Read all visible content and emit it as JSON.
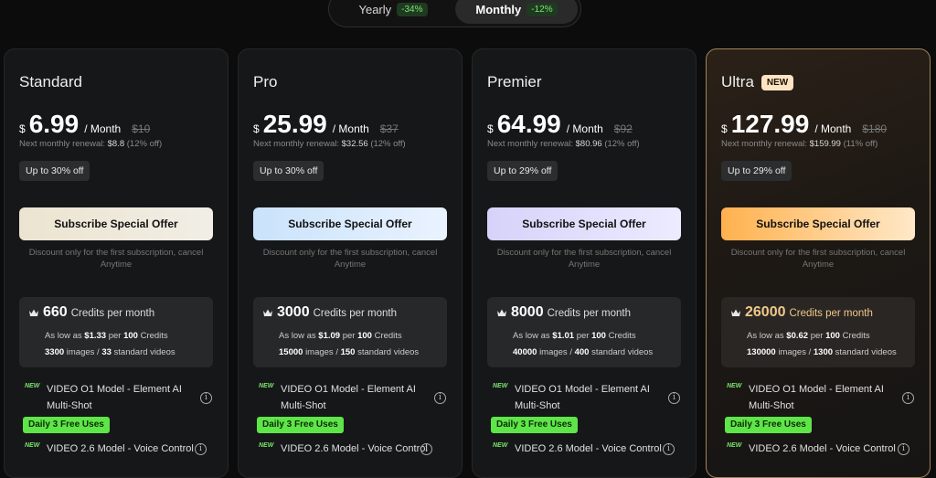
{
  "billing_toggle": {
    "yearly_label": "Yearly",
    "yearly_discount": "-34%",
    "monthly_label": "Monthly",
    "monthly_discount": "-12%",
    "selected": "Monthly"
  },
  "plans": [
    {
      "name": "Standard",
      "currency": "$",
      "price": "6.99",
      "per": "/ Month",
      "original_price": "$10",
      "renewal_label": "Next monthly renewal:",
      "renewal_price": "$8.8",
      "renewal_off": "(12% off)",
      "up_to": "Up to 30% off",
      "button_label": "Subscribe Special Offer",
      "note": "Discount only for the first subscription, cancel Anytime",
      "credits": "660",
      "credits_label": "Credits per month",
      "as_low_as": "As low as",
      "low_price": "$1.33",
      "per_word": "per",
      "per_credits": "100",
      "credits_word": "Credits",
      "images": "3300",
      "images_label": "images /",
      "videos": "33",
      "videos_label": "standard videos",
      "feature1_new": "NEW",
      "feature1": "VIDEO O1 Model - Element AI Multi-Shot",
      "free_badge": "Daily 3 Free Uses",
      "feature2_new": "NEW",
      "feature2": "VIDEO 2.6 Model - Voice Control"
    },
    {
      "name": "Pro",
      "currency": "$",
      "price": "25.99",
      "per": "/ Month",
      "original_price": "$37",
      "renewal_label": "Next monthly renewal:",
      "renewal_price": "$32.56",
      "renewal_off": "(12% off)",
      "up_to": "Up to 30% off",
      "button_label": "Subscribe Special Offer",
      "note": "Discount only for the first subscription, cancel Anytime",
      "credits": "3000",
      "credits_label": "Credits per month",
      "as_low_as": "As low as",
      "low_price": "$1.09",
      "per_word": "per",
      "per_credits": "100",
      "credits_word": "Credits",
      "images": "15000",
      "images_label": "images /",
      "videos": "150",
      "videos_label": "standard videos",
      "feature1_new": "NEW",
      "feature1": "VIDEO O1 Model - Element AI Multi-Shot",
      "free_badge": "Daily 3 Free Uses",
      "feature2_new": "NEW",
      "feature2": "VIDEO 2.6 Model - Voice Control"
    },
    {
      "name": "Premier",
      "currency": "$",
      "price": "64.99",
      "per": "/ Month",
      "original_price": "$92",
      "renewal_label": "Next monthly renewal:",
      "renewal_price": "$80.96",
      "renewal_off": "(12% off)",
      "up_to": "Up to 29% off",
      "button_label": "Subscribe Special Offer",
      "note": "Discount only for the first subscription, cancel Anytime",
      "credits": "8000",
      "credits_label": "Credits per month",
      "as_low_as": "As low as",
      "low_price": "$1.01",
      "per_word": "per",
      "per_credits": "100",
      "credits_word": "Credits",
      "images": "40000",
      "images_label": "images /",
      "videos": "400",
      "videos_label": "standard videos",
      "feature1_new": "NEW",
      "feature1": "VIDEO O1 Model - Element AI Multi-Shot",
      "free_badge": "Daily 3 Free Uses",
      "feature2_new": "NEW",
      "feature2": "VIDEO 2.6 Model - Voice Control"
    },
    {
      "name": "Ultra",
      "badge": "NEW",
      "currency": "$",
      "price": "127.99",
      "per": "/ Month",
      "original_price": "$180",
      "renewal_label": "Next monthly renewal:",
      "renewal_price": "$159.99",
      "renewal_off": "(11% off)",
      "up_to": "Up to 29% off",
      "button_label": "Subscribe Special Offer",
      "note": "Discount only for the first subscription, cancel Anytime",
      "credits": "26000",
      "credits_label": "Credits per month",
      "as_low_as": "As low as",
      "low_price": "$0.62",
      "per_word": "per",
      "per_credits": "100",
      "credits_word": "Credits",
      "images": "130000",
      "images_label": "images /",
      "videos": "1300",
      "videos_label": "standard videos",
      "feature1_new": "NEW",
      "feature1": "VIDEO O1 Model - Element AI Multi-Shot",
      "free_badge": "Daily 3 Free Uses",
      "feature2_new": "NEW",
      "feature2": "VIDEO 2.6 Model - Voice Control"
    }
  ],
  "colors": {
    "background": "#0c0c0c",
    "card": "#161718",
    "discount_green": "#7ce36f",
    "free_badge_green": "#5ee548",
    "ultra_border": "#a0835a"
  },
  "icons": [
    "crown-icon",
    "info-icon"
  ]
}
